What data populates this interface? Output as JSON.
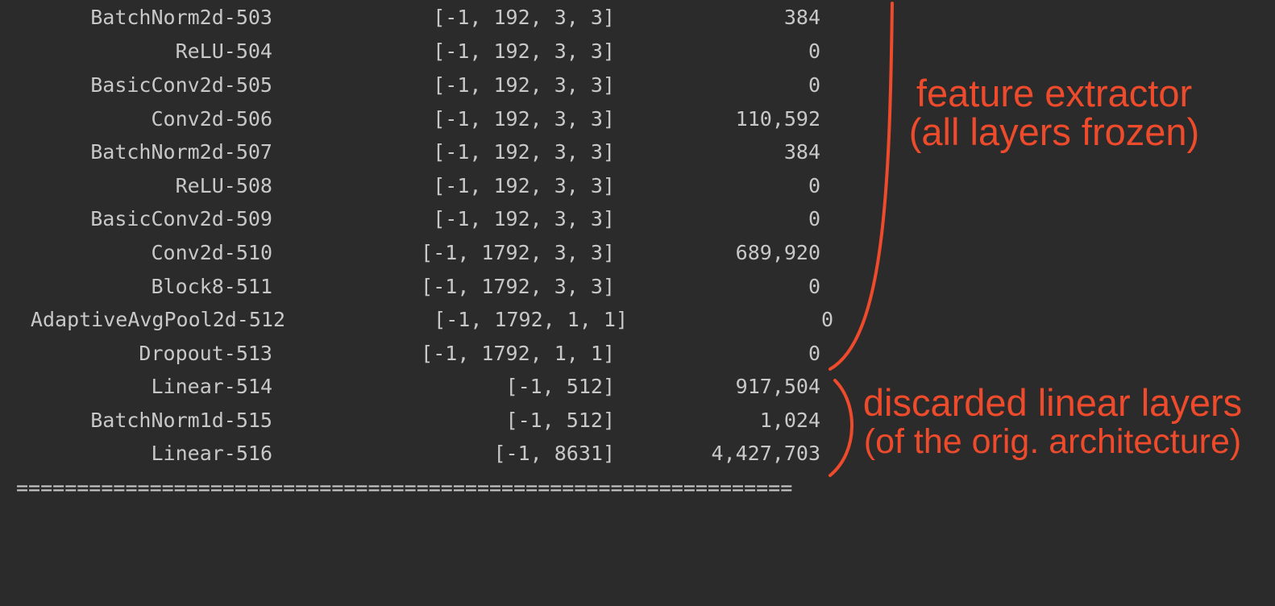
{
  "rows": [
    {
      "layer": "BatchNorm2d-503",
      "shape": "[-1, 192, 3, 3]",
      "params": "384"
    },
    {
      "layer": "ReLU-504",
      "shape": "[-1, 192, 3, 3]",
      "params": "0"
    },
    {
      "layer": "BasicConv2d-505",
      "shape": "[-1, 192, 3, 3]",
      "params": "0"
    },
    {
      "layer": "Conv2d-506",
      "shape": "[-1, 192, 3, 3]",
      "params": "110,592"
    },
    {
      "layer": "BatchNorm2d-507",
      "shape": "[-1, 192, 3, 3]",
      "params": "384"
    },
    {
      "layer": "ReLU-508",
      "shape": "[-1, 192, 3, 3]",
      "params": "0"
    },
    {
      "layer": "BasicConv2d-509",
      "shape": "[-1, 192, 3, 3]",
      "params": "0"
    },
    {
      "layer": "Conv2d-510",
      "shape": "[-1, 1792, 3, 3]",
      "params": "689,920"
    },
    {
      "layer": "Block8-511",
      "shape": "[-1, 1792, 3, 3]",
      "params": "0"
    },
    {
      "layer": "AdaptiveAvgPool2d-512",
      "shape": "[-1, 1792, 1, 1]",
      "params": "0"
    },
    {
      "layer": "Dropout-513",
      "shape": "[-1, 1792, 1, 1]",
      "params": "0"
    },
    {
      "layer": "Linear-514",
      "shape": "[-1, 512]",
      "params": "917,504"
    },
    {
      "layer": "BatchNorm1d-515",
      "shape": "[-1, 512]",
      "params": "1,024"
    },
    {
      "layer": "Linear-516",
      "shape": "[-1, 8631]",
      "params": "4,427,703"
    }
  ],
  "separator": "================================================================",
  "annotations": {
    "feature_extractor": {
      "line1": "feature extractor",
      "line2": "(all layers frozen)"
    },
    "discarded": {
      "line1": "discarded linear layers",
      "line2": "(of the orig. architecture)"
    }
  },
  "colors": {
    "background": "#2b2b2b",
    "text": "#c8c8c8",
    "annotation": "#ee4a2c"
  }
}
